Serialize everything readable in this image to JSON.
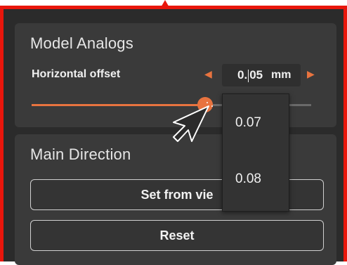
{
  "panel": {
    "model_analogs": {
      "title": "Model Analogs",
      "horizontal_offset": {
        "label": "Horizontal offset",
        "value": "0.05",
        "unit": "mm",
        "slider_fraction": 0.62
      },
      "dropdown_options": [
        "0.07",
        "0.08"
      ]
    },
    "main_direction": {
      "title": "Main Direction",
      "set_from_view_label": "Set from vie",
      "reset_label": "Reset"
    }
  },
  "colors": {
    "accent": "#e8733f",
    "highlight_border": "#e8160c",
    "panel_bg": "#3a3a3a"
  },
  "icons": {
    "decrement": "left-triangle",
    "increment": "right-triangle",
    "cursor": "arrow-cursor"
  }
}
